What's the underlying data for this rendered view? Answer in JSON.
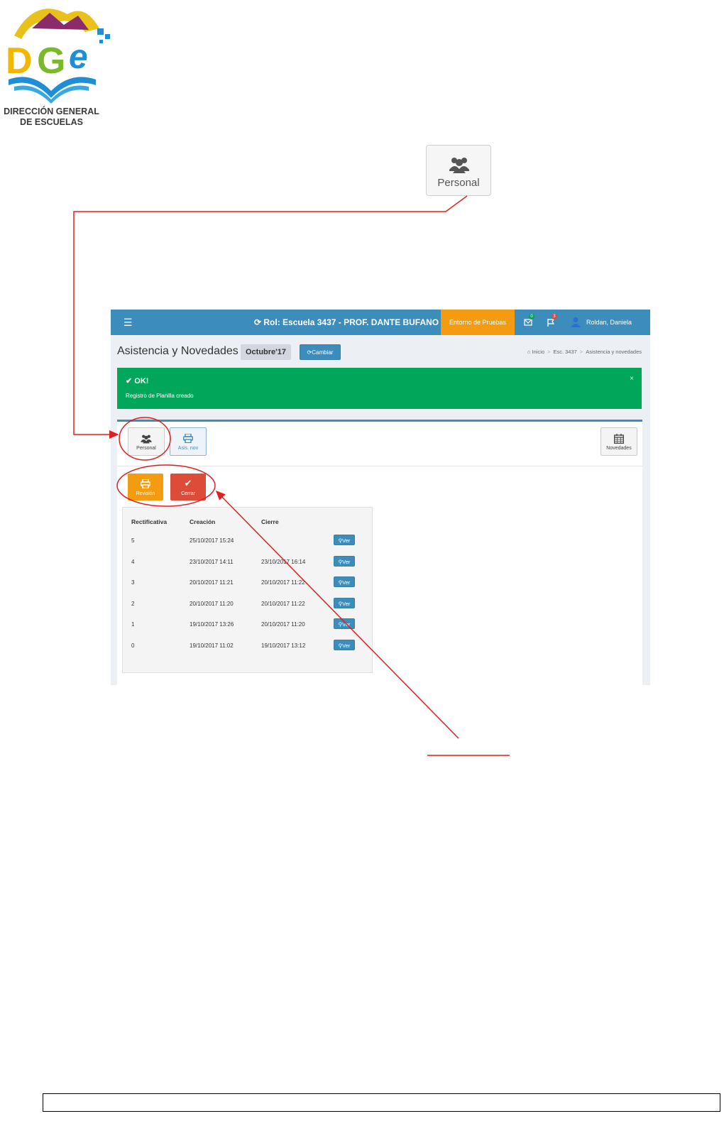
{
  "logo": {
    "text": "DGe",
    "caption_line1": "DIRECCIÓN GENERAL",
    "caption_line2": "DE ESCUELAS"
  },
  "callout": {
    "label": "Personal",
    "icon": "users-icon"
  },
  "screen": {
    "navbar": {
      "menu_icon": "hamburger-icon",
      "role": "Rol: Escuela 3437 - PROF. DANTE BUFANO",
      "environment": "Entorno de Pruebas",
      "mail_badge": "0",
      "flag_badge": "3",
      "user": "Roldan, Daniela"
    },
    "page_title": "Asistencia y Novedades",
    "month": "Octubre'17",
    "change_button": "Cambiar",
    "breadcrumb": [
      "Inicio",
      "Esc. 3437",
      "Asistencia y novedades"
    ],
    "alert": {
      "title": "OK!",
      "message": "Registro de Planilla creado",
      "close": "×"
    },
    "tiles": {
      "personal": "Personal",
      "asis_nov": "Asis. nov",
      "novedades": "Novedades"
    },
    "actions": {
      "revision": "Revisión",
      "cerrar": "Cerrar"
    },
    "table": {
      "headers": [
        "Rectificativa",
        "Creación",
        "Cierre"
      ],
      "rows": [
        {
          "rect": "5",
          "creacion": "25/10/2017 15:24",
          "cierre": "",
          "action": "Ver"
        },
        {
          "rect": "4",
          "creacion": "23/10/2017 14:11",
          "cierre": "23/10/2017 16:14",
          "action": "Ver"
        },
        {
          "rect": "3",
          "creacion": "20/10/2017 11:21",
          "cierre": "20/10/2017 11:22",
          "action": "Ver"
        },
        {
          "rect": "2",
          "creacion": "20/10/2017 11:20",
          "cierre": "20/10/2017 11:22",
          "action": "Ver"
        },
        {
          "rect": "1",
          "creacion": "19/10/2017 13:26",
          "cierre": "20/10/2017 11:20",
          "action": "Ver"
        },
        {
          "rect": "0",
          "creacion": "19/10/2017 11:02",
          "cierre": "19/10/2017 13:12",
          "action": "Ver"
        }
      ]
    }
  },
  "colors": {
    "primary": "#3c8dbc",
    "warning": "#f39c12",
    "success": "#00a65a",
    "danger": "#dd4b39",
    "annotation": "#e02020"
  }
}
